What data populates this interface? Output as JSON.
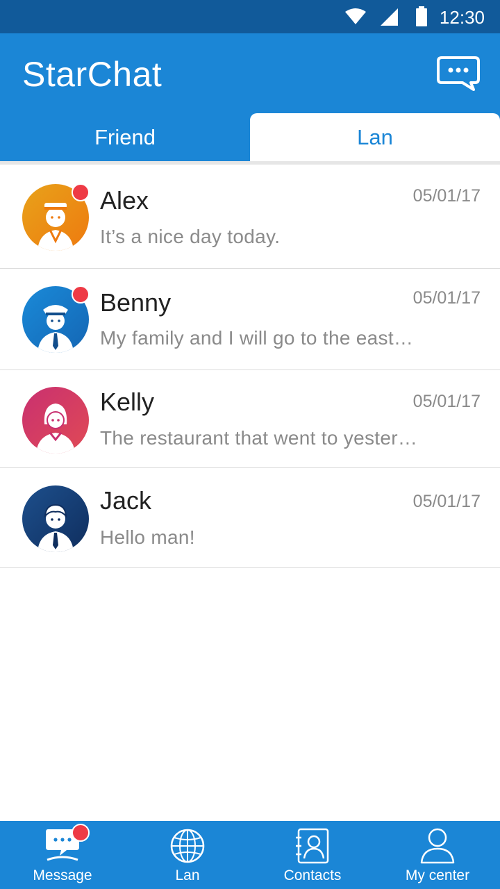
{
  "status_bar": {
    "time": "12:30",
    "icons": [
      "wifi-icon",
      "signal-icon",
      "battery-icon"
    ]
  },
  "app": {
    "title": "StarChat",
    "chat_icon": "chat-bubble-icon"
  },
  "tabs": [
    {
      "label": "Friend",
      "active": false
    },
    {
      "label": "Lan",
      "active": true
    }
  ],
  "colors": {
    "primary": "#1b86d6",
    "status_bar": "#115a9a",
    "badge": "#ee3a45",
    "text_secondary": "#8a8a8a"
  },
  "conversations": [
    {
      "name": "Alex",
      "date": "05/01/17",
      "message": "It’s a nice day today.",
      "unread": true,
      "avatar": "sailor-avatar"
    },
    {
      "name": "Benny",
      "date": "05/01/17",
      "message": "My family and I will go to the east…",
      "unread": true,
      "avatar": "pilot-avatar"
    },
    {
      "name": "Kelly",
      "date": "05/01/17",
      "message": "The restaurant that went to yester…",
      "unread": false,
      "avatar": "woman-avatar"
    },
    {
      "name": "Jack",
      "date": "05/01/17",
      "message": "Hello man!",
      "unread": false,
      "avatar": "man-avatar"
    }
  ],
  "bottom_nav": [
    {
      "label": "Message",
      "icon": "message-icon",
      "badge": true
    },
    {
      "label": "Lan",
      "icon": "globe-icon",
      "badge": false
    },
    {
      "label": "Contacts",
      "icon": "contacts-icon",
      "badge": false
    },
    {
      "label": "My center",
      "icon": "person-icon",
      "badge": false
    }
  ]
}
